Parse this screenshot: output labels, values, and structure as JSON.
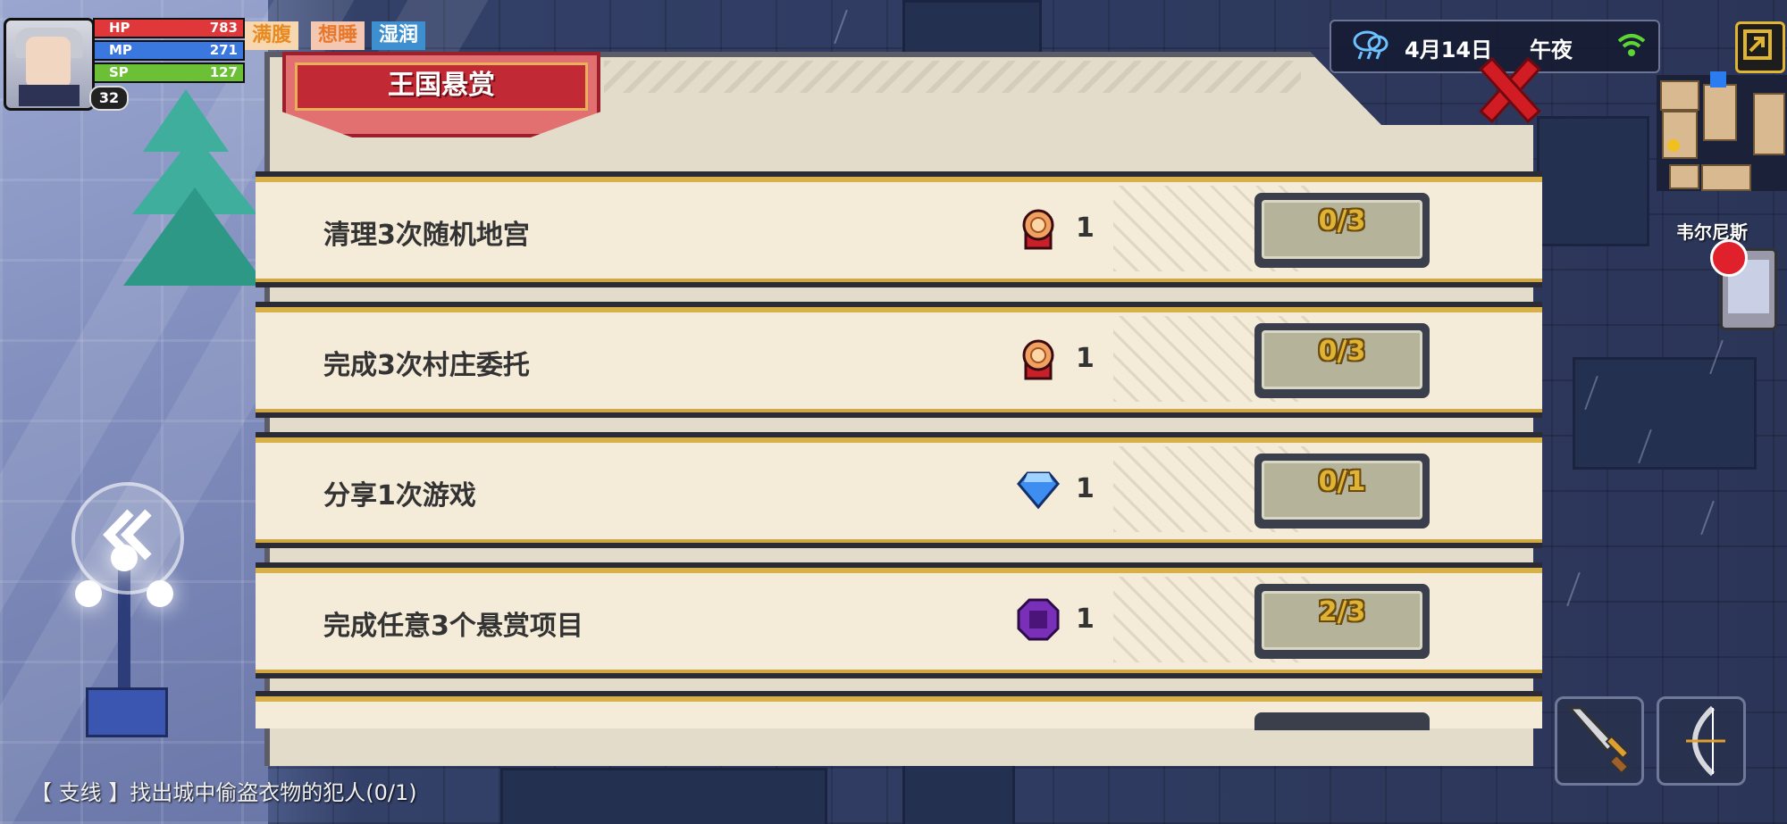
{
  "player": {
    "level": "32",
    "hp": {
      "label": "HP",
      "value": "783",
      "fraction": 1.0,
      "color": "#e0383a"
    },
    "mp": {
      "label": "MP",
      "value": "271",
      "fraction": 1.0,
      "color": "#3a78e0"
    },
    "sp": {
      "label": "SP",
      "value": "127",
      "fraction": 1.0,
      "color": "#6cc036"
    },
    "status_tags": [
      {
        "label": "满腹",
        "color": "#e88a20",
        "bg": "#f6d7b0"
      },
      {
        "label": "想睡",
        "color": "#e8782a",
        "bg": "#f3c7b2"
      },
      {
        "label": "湿润",
        "color": "#ffffff",
        "bg": "#3d8fd0"
      }
    ]
  },
  "header": {
    "date": "4月14日",
    "time": "午夜",
    "weather_icon": "rain-cloud-icon",
    "location": "韦尔尼斯"
  },
  "panel": {
    "title": "王国悬赏",
    "bounties": [
      {
        "task": "清理3次随机地宫",
        "reward_icon": "medal-icon",
        "reward_count": "1",
        "progress": "0/3"
      },
      {
        "task": "完成3次村庄委托",
        "reward_icon": "medal-icon",
        "reward_count": "1",
        "progress": "0/3"
      },
      {
        "task": "分享1次游戏",
        "reward_icon": "diamond-icon",
        "reward_count": "1",
        "progress": "0/1"
      },
      {
        "task": "完成任意3个悬赏项目",
        "reward_icon": "purple-gem-icon",
        "reward_count": "1",
        "progress": "2/3"
      }
    ]
  },
  "quest": {
    "text": "【 支线 】找出城中偷盗衣物的犯人(0/1)"
  }
}
